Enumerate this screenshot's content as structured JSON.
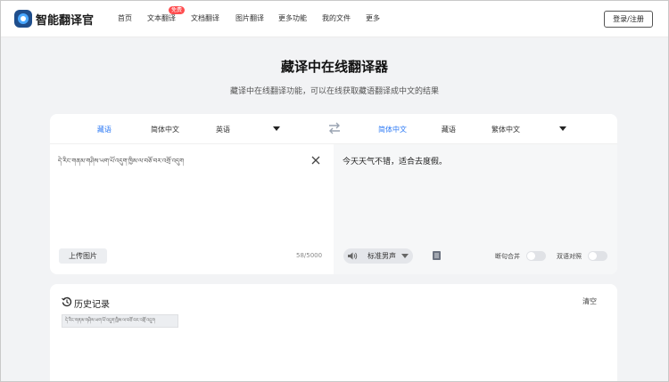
{
  "header": {
    "brand": "智能翻译官",
    "nav": [
      {
        "label": "首页"
      },
      {
        "label": "文本翻译",
        "badge": "免费"
      },
      {
        "label": "文档翻译"
      },
      {
        "label": "图片翻译"
      },
      {
        "label": "更多功能"
      },
      {
        "label": "我的文件"
      },
      {
        "label": "更多"
      }
    ],
    "login": "登录/注册"
  },
  "hero": {
    "title": "藏译中在线翻译器",
    "subtitle": "藏译中在线翻译功能，可以在线获取藏语翻译成中文的结果"
  },
  "translator": {
    "source_langs": [
      "藏语",
      "简体中文",
      "英语"
    ],
    "source_active": 0,
    "target_langs": [
      "简体中文",
      "藏语",
      "繁体中文"
    ],
    "target_active": 0,
    "source_text": "དེ་རིང་གནམ་གཤིས་ཡག་པོ་འདུག་ཁྱིམ་ལ་བཅོ་བར་འགྲོ་འདུག",
    "char_count": "58/5000",
    "upload_label": "上传图片",
    "target_text": "今天天气不错，适合去度假。",
    "voice_label": "标准男声",
    "toggle_split": "断句合并",
    "toggle_bilingual": "双语对照"
  },
  "history": {
    "title": "历史记录",
    "clear": "清空",
    "items": [
      "དེ་རིང་གནམ་གཤིས་ཡག་པོ་འདུག་ཁྱིམ་ལ་བཅོ་བར་འགྲོ་འདུག"
    ]
  },
  "colors": {
    "accent": "#2f7bf5",
    "badge": "#ff4d4f",
    "page_bg": "#f2f3f5"
  }
}
